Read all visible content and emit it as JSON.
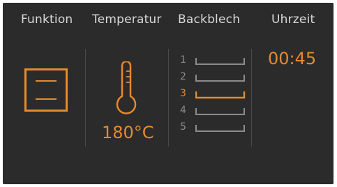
{
  "colors": {
    "background": "#2b2b2b",
    "accent": "#e58a2e",
    "inactive": "#8c8c8c",
    "header_text": "#d9d9d9"
  },
  "headers": {
    "function": "Funktion",
    "temperature": "Temperatur",
    "tray": "Backblech",
    "time": "Uhrzeit"
  },
  "function": {
    "icon": "top-bottom-heat-icon"
  },
  "temperature": {
    "icon": "thermometer-icon",
    "value": "180°C"
  },
  "tray": {
    "selected": "3",
    "levels": [
      {
        "label": "1",
        "active": false
      },
      {
        "label": "2",
        "active": false
      },
      {
        "label": "3",
        "active": true
      },
      {
        "label": "4",
        "active": false
      },
      {
        "label": "5",
        "active": false
      }
    ]
  },
  "time": {
    "value": "00:45"
  }
}
